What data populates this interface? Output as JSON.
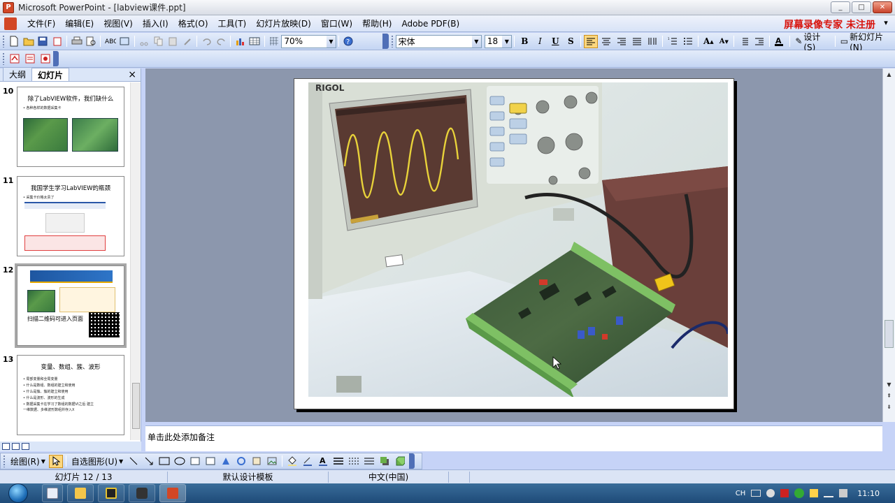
{
  "window": {
    "title": "Microsoft PowerPoint - [labview课件.ppt]",
    "buttons": {
      "min": "_",
      "max": "□",
      "close": "✕"
    }
  },
  "menubar": {
    "items": [
      "文件(F)",
      "编辑(E)",
      "视图(V)",
      "插入(I)",
      "格式(O)",
      "工具(T)",
      "幻灯片放映(D)",
      "窗口(W)",
      "帮助(H)",
      "Adobe PDF(B)"
    ],
    "banner": "屏幕录像专家  未注册"
  },
  "toolbar": {
    "zoom": "70%",
    "font_name": "宋体",
    "font_size": "18",
    "design_label": "设计(S)",
    "new_slide_label": "新幻灯片(N)"
  },
  "leftpane": {
    "tabs": [
      "大纲",
      "幻灯片"
    ],
    "slides": [
      {
        "num": "10",
        "title": "除了LabVIEW软件，我们缺什么",
        "lines": [
          "• 各种各样的数据采集卡"
        ]
      },
      {
        "num": "11",
        "title": "我国学生学习LabVIEW的瓶颈",
        "lines": [
          "• 采集卡价格太贵了"
        ]
      },
      {
        "num": "12",
        "title": "扫描二维码可进入页面",
        "lines": []
      },
      {
        "num": "13",
        "title": "变量、数组、簇、波形",
        "lines": [
          "• 局部变量和全局变量",
          "• 什么是数组、数组的建立和使用",
          "• 什么是簇、簇的建立和使用",
          "• 什么是波形、波形的生成",
          "• 数据采集卡在学习了数组的数据VI之后 建立",
          "  一维数据、多维波形数组并存入X"
        ]
      }
    ]
  },
  "notes": {
    "placeholder": "单击此处添加备注"
  },
  "drawbar": {
    "draw_label": "绘图(R)",
    "autoshape_label": "自选图形(U)"
  },
  "statusbar": {
    "slide_info": "幻灯片 12 / 13",
    "template": "默认设计模板",
    "language": "中文(中国)"
  },
  "taskbar": {
    "input_lang": "CH",
    "time": "11:10"
  }
}
